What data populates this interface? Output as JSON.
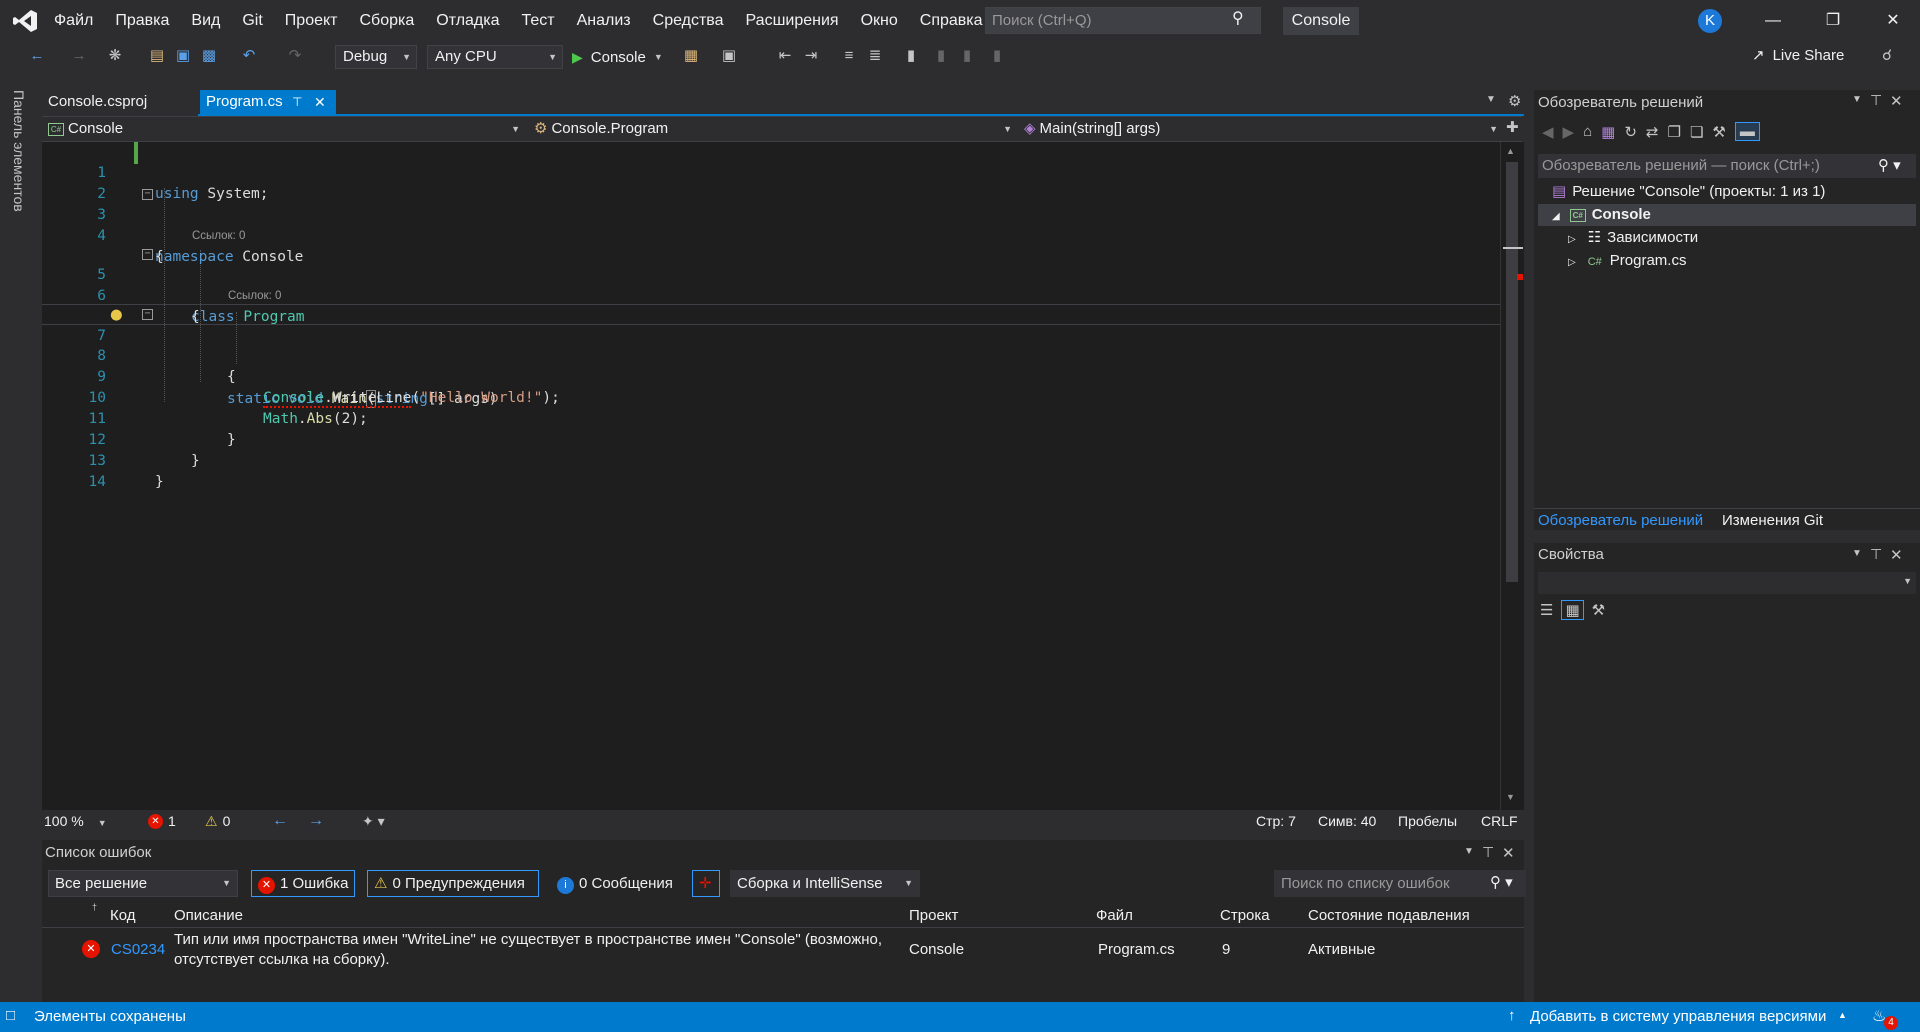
{
  "menu": {
    "items": [
      "Файл",
      "Правка",
      "Вид",
      "Git",
      "Проект",
      "Сборка",
      "Отладка",
      "Тест",
      "Анализ",
      "Средства",
      "Расширения",
      "Окно",
      "Справка"
    ],
    "search_placeholder": "Поиск (Ctrl+Q)",
    "solution_name": "Console",
    "user_initial": "K"
  },
  "toolbar": {
    "configuration": "Debug",
    "platform": "Any CPU",
    "start_label": "Console",
    "live_share": "Live Share"
  },
  "toolbox": {
    "label": "Панель элементов"
  },
  "tabs": [
    {
      "label": "Console.csproj",
      "active": false
    },
    {
      "label": "Program.cs",
      "active": true
    }
  ],
  "navbar": {
    "project": "Console",
    "type": "Console.Program",
    "member": "Main(string[] args)"
  },
  "code": {
    "lines": [
      "1",
      "2",
      "3",
      "4",
      "5",
      "6",
      "7",
      "8",
      "9",
      "10",
      "11",
      "12",
      "13",
      "14"
    ],
    "codelens": "Ссылок: 0",
    "text": {
      "using": "using",
      "system": " System;",
      "namespace": "namespace",
      "console_ns": " Console",
      "open_brace": "{",
      "close_brace": "}",
      "class": "class",
      "program": "Program",
      "static": "static",
      "void": "void",
      "main": "Main",
      "string": "string",
      "args_tail": "[] args)",
      "paren_open": "(",
      "console": "Console",
      "dot": ".",
      "writeline": "WriteLine",
      "hello": "\"Hello World!\"",
      "semi_tail": ");",
      "math": "Math",
      "abs": "Abs",
      "abs_args": "(2);"
    }
  },
  "editor_status": {
    "zoom": "100 %",
    "errors": "1",
    "warnings": "0",
    "line": "Стр: 7",
    "col": "Симв: 40",
    "whitespace": "Пробелы",
    "eol": "CRLF"
  },
  "solution_explorer": {
    "title": "Обозреватель решений",
    "search_placeholder": "Обозреватель решений — поиск (Ctrl+;)",
    "solution": "Решение \"Console\" (проекты: 1 из 1)",
    "project": "Console",
    "dependencies": "Зависимости",
    "file": "Program.cs",
    "tab_solution": "Обозреватель решений",
    "tab_git": "Изменения Git"
  },
  "properties": {
    "title": "Свойства"
  },
  "error_list": {
    "title": "Список ошибок",
    "scope": "Все решение",
    "errors_btn": "1 Ошибка",
    "warnings_btn": "0 Предупреждения",
    "messages_btn": "0 Сообщения",
    "source": "Сборка и IntelliSense",
    "search_placeholder": "Поиск по списку ошибок",
    "columns": {
      "code": "Код",
      "description": "Описание",
      "project": "Проект",
      "file": "Файл",
      "line": "Строка",
      "suppression": "Состояние подавления"
    },
    "rows": [
      {
        "code": "CS0234",
        "description_1": "Тип или имя пространства имен \"WriteLine\" не существует в пространстве имен \"Console\" (возможно,",
        "description_2": "отсутствует ссылка на сборку).",
        "project": "Console",
        "file": "Program.cs",
        "line": "9",
        "suppression": "Активные"
      }
    ]
  },
  "statusbar": {
    "message": "Элементы сохранены",
    "source_control": "Добавить в систему управления версиями",
    "notifications": "4"
  }
}
